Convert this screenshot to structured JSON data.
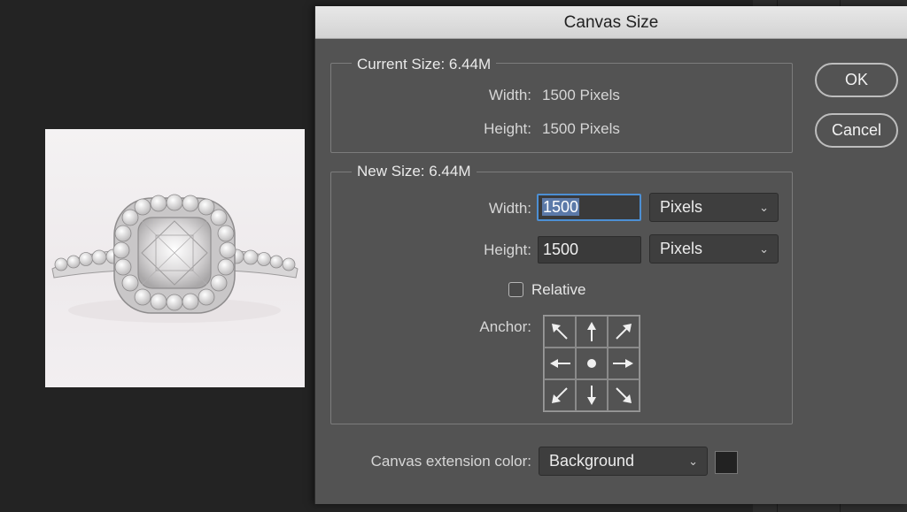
{
  "dialog": {
    "title": "Canvas Size"
  },
  "current_size": {
    "title": "Current Size: 6.44M",
    "width_label": "Width:",
    "width_value": "1500 Pixels",
    "height_label": "Height:",
    "height_value": "1500 Pixels"
  },
  "new_size": {
    "title": "New Size: 6.44M",
    "width_label": "Width:",
    "width_value": "1500",
    "width_unit": "Pixels",
    "height_label": "Height:",
    "height_value": "1500",
    "height_unit": "Pixels",
    "relative_label": "Relative",
    "relative_checked": false,
    "anchor_label": "Anchor:",
    "anchor_cells": [
      "arrow-up-left-icon",
      "arrow-up-icon",
      "arrow-up-right-icon",
      "arrow-left-icon",
      "anchor-dot-icon",
      "arrow-right-icon",
      "arrow-down-left-icon",
      "arrow-down-icon",
      "arrow-down-right-icon"
    ]
  },
  "extension": {
    "label": "Canvas extension color:",
    "value": "Background",
    "swatch_color": "#222222"
  },
  "buttons": {
    "ok": "OK",
    "cancel": "Cancel"
  },
  "chevron": "⌄",
  "colors": {
    "dialog_bg": "#535353",
    "focus_ring": "#4c8fd4",
    "selection": "#5b79a8"
  }
}
